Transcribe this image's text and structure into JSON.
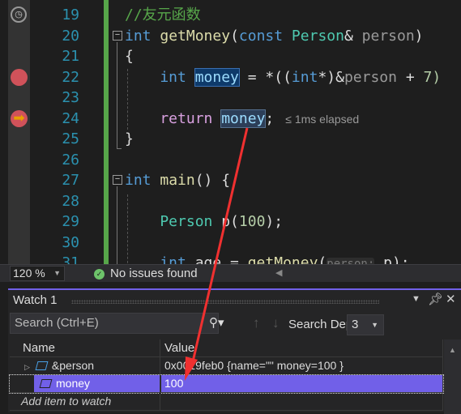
{
  "editor": {
    "line_numbers": [
      "19",
      "20",
      "21",
      "22",
      "23",
      "24",
      "25",
      "26",
      "27",
      "28",
      "29",
      "30",
      "31"
    ],
    "lines": [
      [
        {
          "t": "//友元函数",
          "c": "comment"
        }
      ],
      [
        {
          "t": "int",
          "c": "kw"
        },
        {
          "t": " getMoney",
          "c": "fn"
        },
        {
          "t": "(",
          "c": "plain"
        },
        {
          "t": "const",
          "c": "kw"
        },
        {
          "t": " Person",
          "c": "type"
        },
        {
          "t": "& ",
          "c": "plain"
        },
        {
          "t": "person",
          "c": "param"
        },
        {
          "t": ")",
          "c": "plain"
        }
      ],
      [
        {
          "t": "{",
          "c": "plain"
        }
      ],
      [
        {
          "t": "    int",
          "c": "kw"
        },
        {
          "t": " ",
          "c": "plain"
        },
        {
          "t": "money",
          "c": "var",
          "hl": "hl1"
        },
        {
          "t": " = *((",
          "c": "plain"
        },
        {
          "t": "int",
          "c": "kw"
        },
        {
          "t": "*)&",
          "c": "plain"
        },
        {
          "t": "person",
          "c": "param"
        },
        {
          "t": " + ",
          "c": "plain"
        },
        {
          "t": "7)",
          "c": "num"
        }
      ],
      [],
      [
        {
          "t": "    return",
          "c": "ctrl"
        },
        {
          "t": " ",
          "c": "plain"
        },
        {
          "t": "money",
          "c": "var",
          "hl": "hl2"
        },
        {
          "t": ";",
          "c": "plain"
        },
        {
          "t": "≤ 1ms elapsed",
          "c": "elapsed"
        }
      ],
      [
        {
          "t": "}",
          "c": "plain"
        }
      ],
      [],
      [
        {
          "t": "int",
          "c": "kw"
        },
        {
          "t": " main",
          "c": "fn"
        },
        {
          "t": "() {",
          "c": "plain"
        }
      ],
      [],
      [
        {
          "t": "    Person",
          "c": "type"
        },
        {
          "t": " p(",
          "c": "plain"
        },
        {
          "t": "100",
          "c": "num"
        },
        {
          "t": ");",
          "c": "plain"
        }
      ],
      [],
      [
        {
          "t": "    int",
          "c": "kw"
        },
        {
          "t": " age = ",
          "c": "plain"
        },
        {
          "t": "getMoney",
          "c": "fn"
        },
        {
          "t": "(",
          "c": "plain"
        },
        {
          "t": "person:",
          "c": "hint"
        },
        {
          "t": " p);",
          "c": "plain"
        }
      ]
    ],
    "colors": {
      "comment": "#57a64a",
      "kw": "#569cd6",
      "fn": "#dcdcaa",
      "type": "#4ec9b0",
      "param": "#9a9a9a",
      "plain": "#dcdcdc",
      "var": "#9cdcfe",
      "num": "#b5cea8",
      "ctrl": "#d8a0df",
      "hint": "#777777",
      "elapsed": "#999999"
    }
  },
  "statusbar": {
    "zoom": "120 %",
    "issues": "No issues found"
  },
  "watch": {
    "title": "Watch 1",
    "search_placeholder": "Search (Ctrl+E)",
    "search_depth_label": "Search Depth:",
    "search_depth": "3",
    "columns": [
      "Name",
      "Value"
    ],
    "rows": [
      {
        "name": "&person",
        "value": "0x0019feb0 {name=\"\" money=100 }"
      },
      {
        "name": "money",
        "value": "100"
      }
    ],
    "add_item": "Add item to watch"
  }
}
